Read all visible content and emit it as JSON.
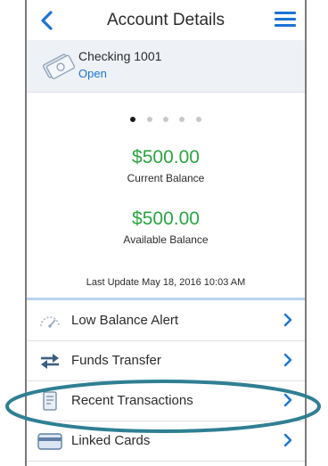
{
  "header": {
    "title": "Account Details"
  },
  "account": {
    "name": "Checking 1001",
    "status": "Open"
  },
  "carousel": {
    "dots": 5,
    "active_index": 0
  },
  "balances": {
    "current": {
      "amount": "$500.00",
      "label": "Current Balance"
    },
    "available": {
      "amount": "$500.00",
      "label": "Available Balance"
    }
  },
  "last_update": "Last Update May 18, 2016 10:03 AM",
  "menu": {
    "items": [
      {
        "label": "Low Balance Alert",
        "icon": "alert-gauge-icon"
      },
      {
        "label": "Funds Transfer",
        "icon": "transfer-arrows-icon"
      },
      {
        "label": "Recent Transactions",
        "icon": "document-icon"
      },
      {
        "label": "Linked Cards",
        "icon": "card-icon"
      }
    ]
  },
  "colors": {
    "accent": "#1a73d6",
    "balance": "#2aa541",
    "highlight": "#2f7f93"
  }
}
